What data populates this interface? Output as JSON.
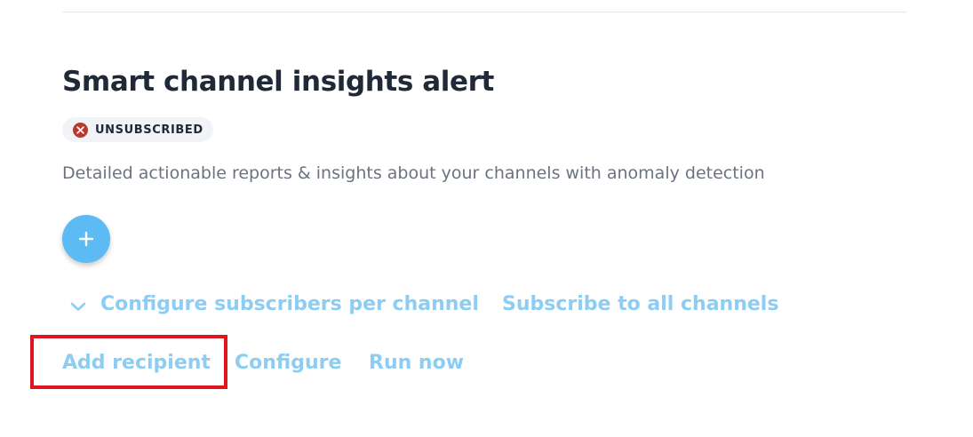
{
  "alert": {
    "title": "Smart channel insights alert",
    "status": "UNSUBSCRIBED",
    "description": "Detailed actionable reports & insights about your channels with anomaly detection"
  },
  "actions": {
    "configure_per_channel": "Configure subscribers per channel",
    "subscribe_all": "Subscribe to all channels",
    "add_recipient": "Add recipient",
    "configure": "Configure",
    "run_now": "Run now"
  },
  "icons": {
    "status": "x-circle-icon",
    "fab": "plus-icon",
    "expand": "chevron-down-icon"
  },
  "colors": {
    "link": "#8dcdf4",
    "fab": "#5bbbf2",
    "status_error": "#b73a2f",
    "highlight": "#e0151d",
    "title": "#1f2937"
  }
}
